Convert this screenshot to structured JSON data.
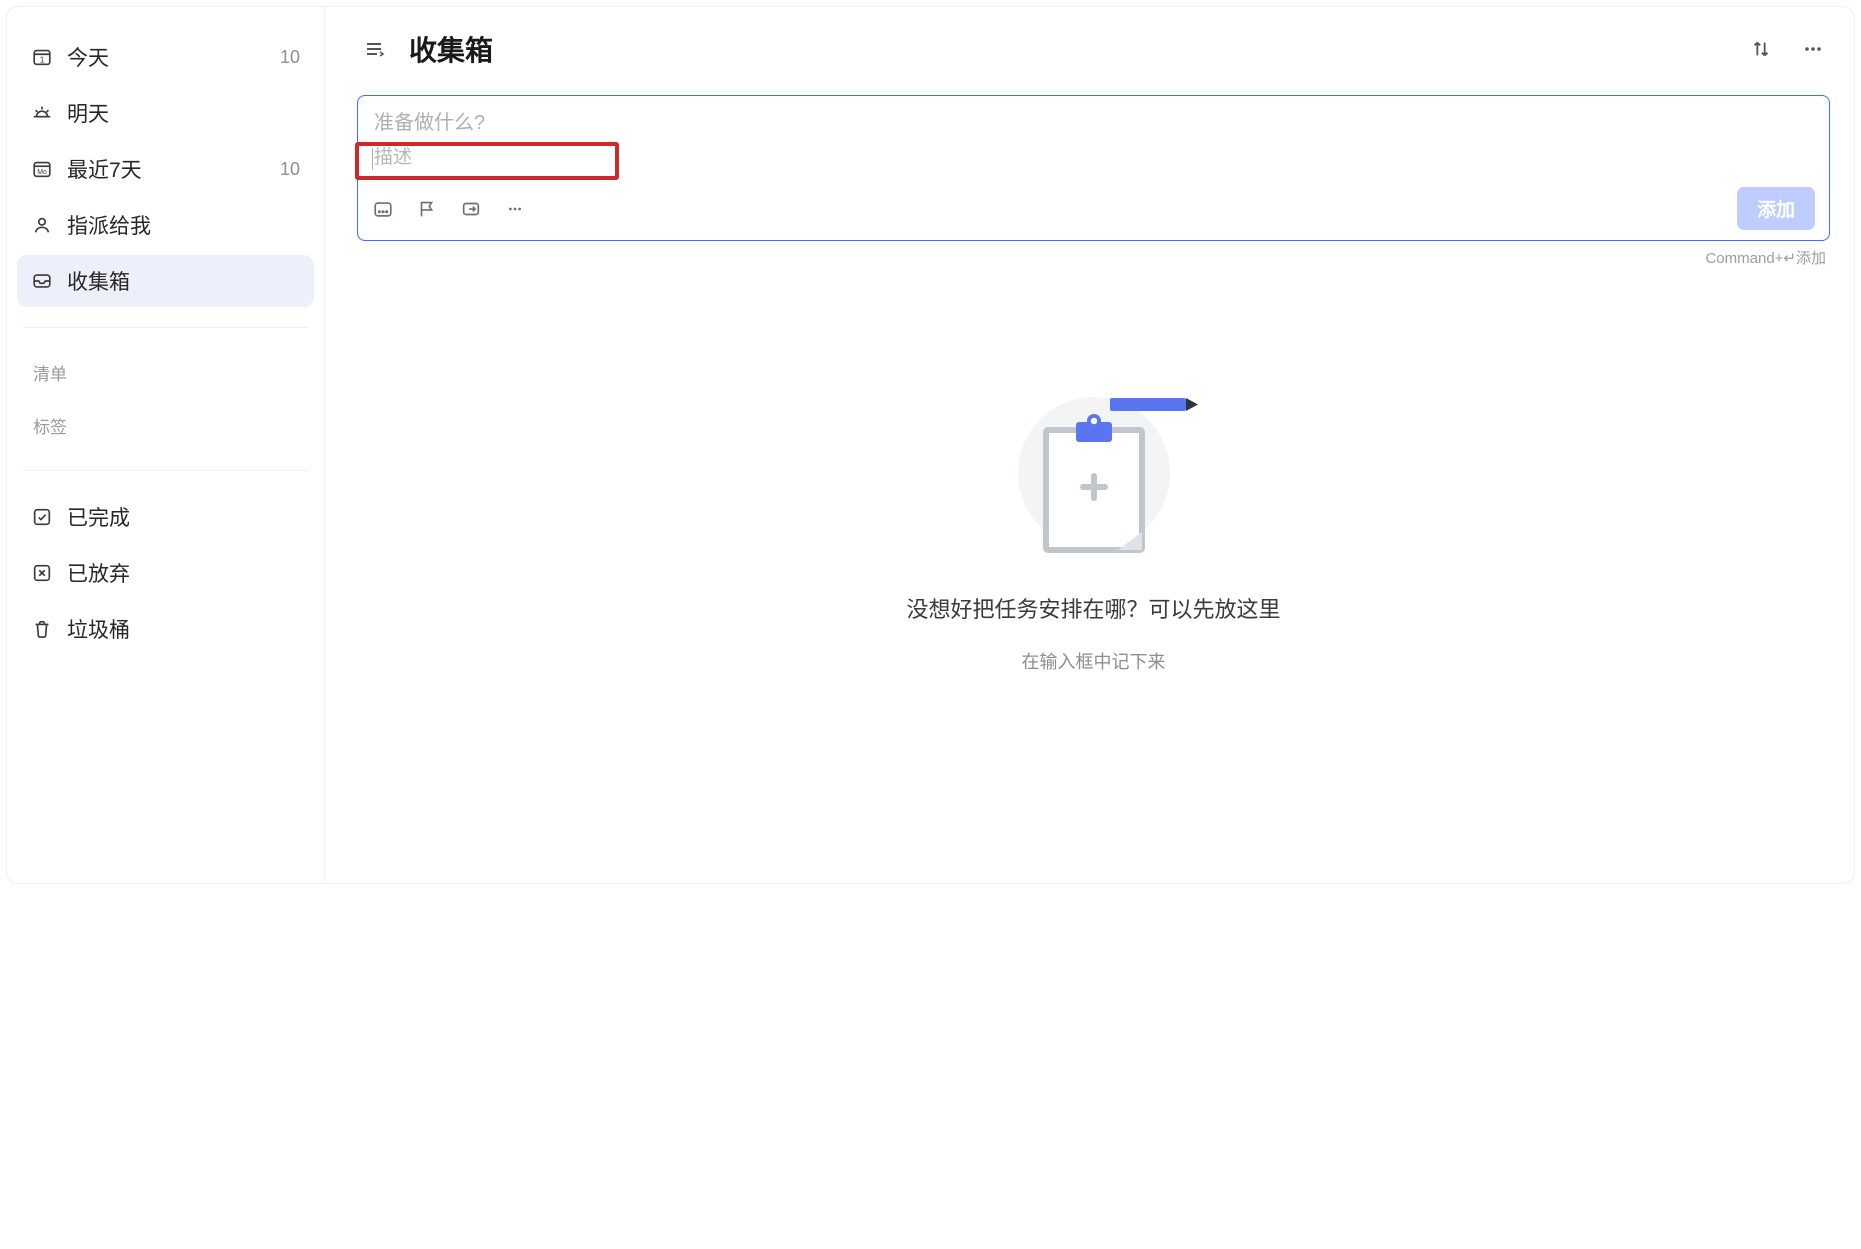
{
  "sidebar": {
    "items": [
      {
        "label": "今天",
        "count": "10"
      },
      {
        "label": "明天",
        "count": ""
      },
      {
        "label": "最近7天",
        "count": "10"
      },
      {
        "label": "指派给我",
        "count": ""
      },
      {
        "label": "收集箱",
        "count": ""
      }
    ],
    "sections": {
      "lists": "清单",
      "tags": "标签"
    },
    "bottom": [
      {
        "label": "已完成"
      },
      {
        "label": "已放弃"
      },
      {
        "label": "垃圾桶"
      }
    ]
  },
  "header": {
    "title": "收集箱"
  },
  "addTask": {
    "title_placeholder": "准备做什么?",
    "desc_placeholder": "描述",
    "button_label": "添加",
    "hint": "Command+↵添加"
  },
  "empty": {
    "title": "没想好把任务安排在哪？可以先放这里",
    "sub": "在输入框中记下来"
  }
}
